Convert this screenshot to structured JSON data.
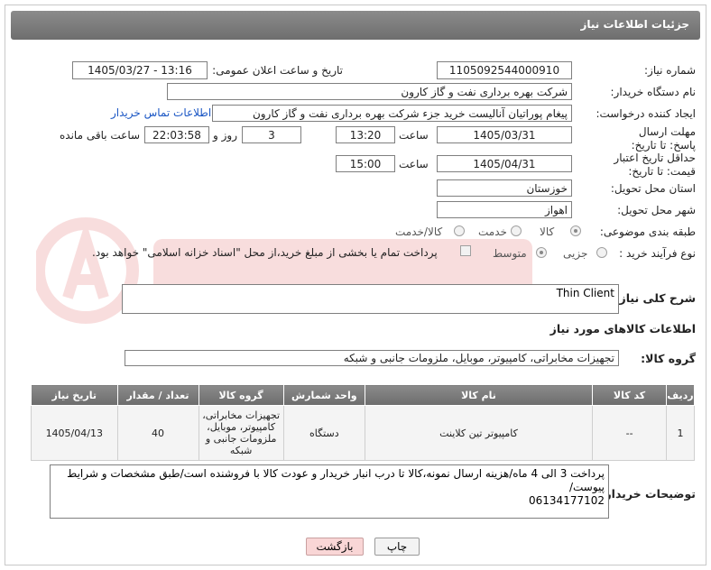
{
  "header": {
    "title": "جزئیات اطلاعات نیاز"
  },
  "fields": {
    "need_number_label": "شماره نیاز:",
    "need_number": "1105092544000910",
    "announce_label": "تاریخ و ساعت اعلان عمومی:",
    "announce_value": "1405/03/27 - 13:16",
    "buyer_org_label": "نام دستگاه خریدار:",
    "buyer_org": "شرکت بهره برداری نفت و گاز کارون",
    "creator_label": "ایجاد کننده درخواست:",
    "creator": "پیغام پوراتیان آنالیست خرید جزء شرکت بهره برداری نفت و گاز کارون",
    "contact_link": "اطلاعات تماس خریدار",
    "reply_deadline_label": "مهلت ارسال پاسخ: تا تاریخ:",
    "reply_date": "1405/03/31",
    "time_label": "ساعت",
    "reply_time": "13:20",
    "days_value": "3",
    "days_label": "روز و",
    "remaining_time": "22:03:58",
    "remaining_label": "ساعت باقی مانده",
    "price_validity_label": "حداقل تاریخ اعتبار قیمت: تا تاریخ:",
    "price_date": "1405/04/31",
    "price_time": "15:00",
    "province_label": "استان محل تحویل:",
    "province": "خوزستان",
    "city_label": "شهر محل تحویل:",
    "city": "اهواز",
    "category_label": "طبقه بندی موضوعی:",
    "category_options": [
      "کالا",
      "خدمت",
      "کالا/خدمت"
    ],
    "process_label": "نوع فرآیند خرید :",
    "process_options": [
      "جزیی",
      "متوسط"
    ],
    "payment_note": "پرداخت تمام یا بخشی از مبلغ خرید،از محل \"اسناد خزانه اسلامی\" خواهد بود."
  },
  "description": {
    "label": "شرح کلی نیاز:",
    "value": "Thin Client"
  },
  "goods_info_title": "اطلاعات کالاهای مورد نیاز",
  "goods_group": {
    "label": "گروه کالا:",
    "value": "تجهیزات مخابراتی، کامپیوتر، موبایل، ملزومات جانبی و شبکه"
  },
  "table": {
    "headers": [
      "ردیف",
      "کد کالا",
      "نام کالا",
      "واحد شمارش",
      "گروه کالا",
      "تعداد / مقدار",
      "تاریخ نیاز"
    ],
    "rows": [
      [
        "1",
        "--",
        "کامپیوتر تین کلاینت",
        "دستگاه",
        "تجهیزات مخابراتی، کامپیوتر، موبایل، ملزومات جانبی و شبکه",
        "40",
        "1405/04/13"
      ]
    ]
  },
  "buyer_notes": {
    "label": "توضیحات خریدار:",
    "value": "پرداخت 3 الی 4 ماه/هزینه ارسال نمونه،کالا تا درب انبار خریدار و عودت کالا با فروشنده است/طبق مشخصات و شرایط پیوست/\n06134177102"
  },
  "buttons": {
    "print": "چاپ",
    "back": "بازگشت"
  },
  "colors": {
    "header_bg": "#7a7a7a",
    "link": "#1a56c4",
    "back_button_bg": "#f9d6d6"
  }
}
